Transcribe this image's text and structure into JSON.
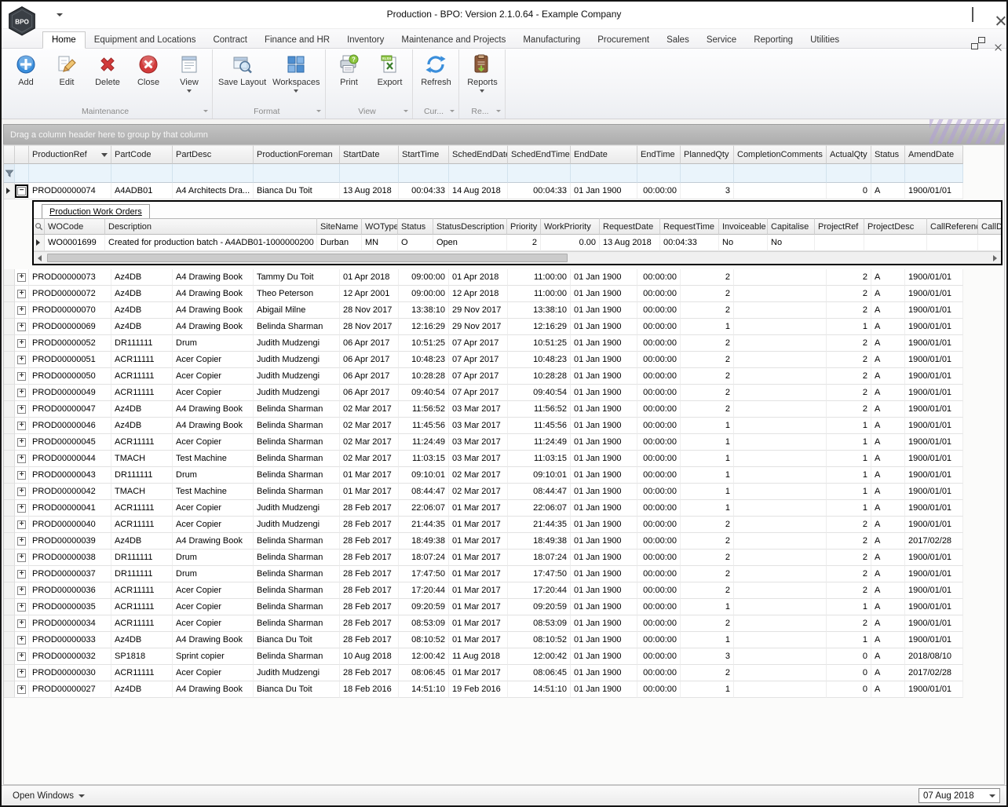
{
  "window": {
    "title": "Production - BPO: Version 2.1.0.64 - Example Company",
    "logo_text": "BPO"
  },
  "ribbon": {
    "tabs": [
      "Home",
      "Equipment and Locations",
      "Contract",
      "Finance and HR",
      "Inventory",
      "Maintenance and Projects",
      "Manufacturing",
      "Procurement",
      "Sales",
      "Service",
      "Reporting",
      "Utilities"
    ],
    "active_tab": "Home",
    "groups": [
      {
        "label": "Maintenance"
      },
      {
        "label": "Format"
      },
      {
        "label": "View"
      },
      {
        "label": "Cur..."
      },
      {
        "label": "Re..."
      }
    ],
    "buttons": {
      "add": "Add",
      "edit": "Edit",
      "delete": "Delete",
      "close": "Close",
      "view": "View",
      "save_layout": "Save Layout",
      "workspaces": "Workspaces",
      "print": "Print",
      "export": "Export",
      "refresh": "Refresh",
      "reports": "Reports"
    }
  },
  "grid": {
    "group_by_hint": "Drag a column header here to group by that column",
    "columns": [
      "ProductionRef",
      "PartCode",
      "PartDesc",
      "ProductionForeman",
      "StartDate",
      "StartTime",
      "SchedEndDate",
      "SchedEndTime",
      "EndDate",
      "EndTime",
      "PlannedQty",
      "CompletionComments",
      "ActualQty",
      "Status",
      "AmendDate"
    ],
    "expanded_row_index": 0,
    "rows": [
      [
        "PROD00000074",
        "A4ADB01",
        "A4 Architects Dra...",
        "Bianca Du Toit",
        "13 Aug 2018",
        "00:04:33",
        "14 Aug 2018",
        "00:04:33",
        "01 Jan 1900",
        "00:00:00",
        "3",
        "",
        "0",
        "A",
        "1900/01/01"
      ],
      [
        "PROD00000073",
        "Az4DB",
        "A4 Drawing Book",
        "Tammy Du Toit",
        "01 Apr 2018",
        "09:00:00",
        "01 Apr 2018",
        "11:00:00",
        "01 Jan 1900",
        "00:00:00",
        "2",
        "",
        "2",
        "A",
        "1900/01/01"
      ],
      [
        "PROD00000072",
        "Az4DB",
        "A4 Drawing Book",
        "Theo Peterson",
        "12 Apr 2001",
        "09:00:00",
        "12 Apr 2018",
        "11:00:00",
        "01 Jan 1900",
        "00:00:00",
        "2",
        "",
        "2",
        "A",
        "1900/01/01"
      ],
      [
        "PROD00000070",
        "Az4DB",
        "A4 Drawing Book",
        "Abigail Milne",
        "28 Nov 2017",
        "13:38:10",
        "29 Nov 2017",
        "13:38:10",
        "01 Jan 1900",
        "00:00:00",
        "2",
        "",
        "2",
        "A",
        "1900/01/01"
      ],
      [
        "PROD00000069",
        "Az4DB",
        "A4 Drawing Book",
        "Belinda Sharman",
        "28 Nov 2017",
        "12:16:29",
        "29 Nov 2017",
        "12:16:29",
        "01 Jan 1900",
        "00:00:00",
        "1",
        "",
        "1",
        "A",
        "1900/01/01"
      ],
      [
        "PROD00000052",
        "DR111111",
        "Drum",
        "Judith Mudzengi",
        "06 Apr 2017",
        "10:51:25",
        "07 Apr 2017",
        "10:51:25",
        "01 Jan 1900",
        "00:00:00",
        "2",
        "",
        "2",
        "A",
        "1900/01/01"
      ],
      [
        "PROD00000051",
        "ACR11111",
        "Acer Copier",
        "Judith Mudzengi",
        "06 Apr 2017",
        "10:48:23",
        "07 Apr 2017",
        "10:48:23",
        "01 Jan 1900",
        "00:00:00",
        "2",
        "",
        "2",
        "A",
        "1900/01/01"
      ],
      [
        "PROD00000050",
        "ACR11111",
        "Acer Copier",
        "Judith Mudzengi",
        "06 Apr 2017",
        "10:28:28",
        "07 Apr 2017",
        "10:28:28",
        "01 Jan 1900",
        "00:00:00",
        "2",
        "",
        "2",
        "A",
        "1900/01/01"
      ],
      [
        "PROD00000049",
        "ACR11111",
        "Acer Copier",
        "Judith Mudzengi",
        "06 Apr 2017",
        "09:40:54",
        "07 Apr 2017",
        "09:40:54",
        "01 Jan 1900",
        "00:00:00",
        "2",
        "",
        "2",
        "A",
        "1900/01/01"
      ],
      [
        "PROD00000047",
        "Az4DB",
        "A4 Drawing Book",
        "Belinda Sharman",
        "02 Mar 2017",
        "11:56:52",
        "03 Mar 2017",
        "11:56:52",
        "01 Jan 1900",
        "00:00:00",
        "2",
        "",
        "2",
        "A",
        "1900/01/01"
      ],
      [
        "PROD00000046",
        "Az4DB",
        "A4 Drawing Book",
        "Belinda Sharman",
        "02 Mar 2017",
        "11:45:56",
        "03 Mar 2017",
        "11:45:56",
        "01 Jan 1900",
        "00:00:00",
        "1",
        "",
        "1",
        "A",
        "1900/01/01"
      ],
      [
        "PROD00000045",
        "ACR11111",
        "Acer Copier",
        "Belinda Sharman",
        "02 Mar 2017",
        "11:24:49",
        "03 Mar 2017",
        "11:24:49",
        "01 Jan 1900",
        "00:00:00",
        "1",
        "",
        "1",
        "A",
        "1900/01/01"
      ],
      [
        "PROD00000044",
        "TMACH",
        "Test Machine",
        "Belinda Sharman",
        "02 Mar 2017",
        "11:03:15",
        "03 Mar 2017",
        "11:03:15",
        "01 Jan 1900",
        "00:00:00",
        "1",
        "",
        "1",
        "A",
        "1900/01/01"
      ],
      [
        "PROD00000043",
        "DR111111",
        "Drum",
        "Belinda Sharman",
        "01 Mar 2017",
        "09:10:01",
        "02 Mar 2017",
        "09:10:01",
        "01 Jan 1900",
        "00:00:00",
        "1",
        "",
        "1",
        "A",
        "1900/01/01"
      ],
      [
        "PROD00000042",
        "TMACH",
        "Test Machine",
        "Belinda Sharman",
        "01 Mar 2017",
        "08:44:47",
        "02 Mar 2017",
        "08:44:47",
        "01 Jan 1900",
        "00:00:00",
        "1",
        "",
        "1",
        "A",
        "1900/01/01"
      ],
      [
        "PROD00000041",
        "ACR11111",
        "Acer Copier",
        "Judith Mudzengi",
        "28 Feb 2017",
        "22:06:07",
        "01 Mar 2017",
        "22:06:07",
        "01 Jan 1900",
        "00:00:00",
        "1",
        "",
        "1",
        "A",
        "1900/01/01"
      ],
      [
        "PROD00000040",
        "ACR11111",
        "Acer Copier",
        "Judith Mudzengi",
        "28 Feb 2017",
        "21:44:35",
        "01 Mar 2017",
        "21:44:35",
        "01 Jan 1900",
        "00:00:00",
        "2",
        "",
        "2",
        "A",
        "1900/01/01"
      ],
      [
        "PROD00000039",
        "Az4DB",
        "A4 Drawing Book",
        "Belinda Sharman",
        "28 Feb 2017",
        "18:49:38",
        "01 Mar 2017",
        "18:49:38",
        "01 Jan 1900",
        "00:00:00",
        "2",
        "",
        "2",
        "A",
        "2017/02/28"
      ],
      [
        "PROD00000038",
        "DR111111",
        "Drum",
        "Belinda Sharman",
        "28 Feb 2017",
        "18:07:24",
        "01 Mar 2017",
        "18:07:24",
        "01 Jan 1900",
        "00:00:00",
        "2",
        "",
        "2",
        "A",
        "1900/01/01"
      ],
      [
        "PROD00000037",
        "DR111111",
        "Drum",
        "Belinda Sharman",
        "28 Feb 2017",
        "17:47:50",
        "01 Mar 2017",
        "17:47:50",
        "01 Jan 1900",
        "00:00:00",
        "2",
        "",
        "2",
        "A",
        "1900/01/01"
      ],
      [
        "PROD00000036",
        "ACR11111",
        "Acer Copier",
        "Belinda Sharman",
        "28 Feb 2017",
        "17:20:44",
        "01 Mar 2017",
        "17:20:44",
        "01 Jan 1900",
        "00:00:00",
        "2",
        "",
        "2",
        "A",
        "1900/01/01"
      ],
      [
        "PROD00000035",
        "ACR11111",
        "Acer Copier",
        "Belinda Sharman",
        "28 Feb 2017",
        "09:20:59",
        "01 Mar 2017",
        "09:20:59",
        "01 Jan 1900",
        "00:00:00",
        "1",
        "",
        "1",
        "A",
        "1900/01/01"
      ],
      [
        "PROD00000034",
        "ACR11111",
        "Acer Copier",
        "Belinda Sharman",
        "28 Feb 2017",
        "08:53:09",
        "01 Mar 2017",
        "08:53:09",
        "01 Jan 1900",
        "00:00:00",
        "2",
        "",
        "2",
        "A",
        "1900/01/01"
      ],
      [
        "PROD00000033",
        "Az4DB",
        "A4 Drawing Book",
        "Bianca Du Toit",
        "28 Feb 2017",
        "08:10:52",
        "01 Mar 2017",
        "08:10:52",
        "01 Jan 1900",
        "00:00:00",
        "1",
        "",
        "1",
        "A",
        "1900/01/01"
      ],
      [
        "PROD00000032",
        "SP1818",
        "Sprint copier",
        "Belinda Sharman",
        "10 Aug 2018",
        "12:00:42",
        "11 Aug 2018",
        "12:00:42",
        "01 Jan 1900",
        "00:00:00",
        "3",
        "",
        "0",
        "A",
        "2018/08/10"
      ],
      [
        "PROD00000030",
        "ACR11111",
        "Acer Copier",
        "Judith Mudzengi",
        "28 Feb 2017",
        "08:06:45",
        "01 Mar 2017",
        "08:06:45",
        "01 Jan 1900",
        "00:00:00",
        "2",
        "",
        "0",
        "A",
        "2017/02/28"
      ],
      [
        "PROD00000027",
        "Az4DB",
        "A4 Drawing Book",
        "Bianca Du Toit",
        "18 Feb 2016",
        "14:51:10",
        "19 Feb 2016",
        "14:51:10",
        "01 Jan 1900",
        "00:00:00",
        "1",
        "",
        "0",
        "A",
        "1900/01/01"
      ]
    ]
  },
  "detail": {
    "tab_label": "Production Work Orders",
    "columns": [
      "WOCode",
      "Description",
      "SiteName",
      "WOType",
      "Status",
      "StatusDescription",
      "Priority",
      "WorkPriority",
      "RequestDate",
      "RequestTime",
      "Invoiceable",
      "Capitalise",
      "ProjectRef",
      "ProjectDesc",
      "CallReference",
      "CallD"
    ],
    "rows": [
      [
        "WO0001699",
        "Created for production batch - A4ADB01-1000000200",
        "Durban",
        "MN",
        "O",
        "Open",
        "2",
        "0.00",
        "13 Aug 2018",
        "00:04:33",
        "No",
        "No",
        "",
        "",
        "",
        ""
      ]
    ]
  },
  "status_bar": {
    "open_windows_label": "Open Windows",
    "date_value": "07 Aug 2018"
  },
  "icons": {
    "expand_collapsed": "+",
    "expand_expanded": "−",
    "row_indicator": "right-arrow",
    "dropdown": "down-triangle"
  },
  "colors": {
    "accent_blue": "#3a8edb",
    "delete_red": "#d23b3b",
    "filter_row_bg": "#eaf4fb",
    "group_panel_gray": "#b4b4b4",
    "detail_border": "#000000"
  }
}
